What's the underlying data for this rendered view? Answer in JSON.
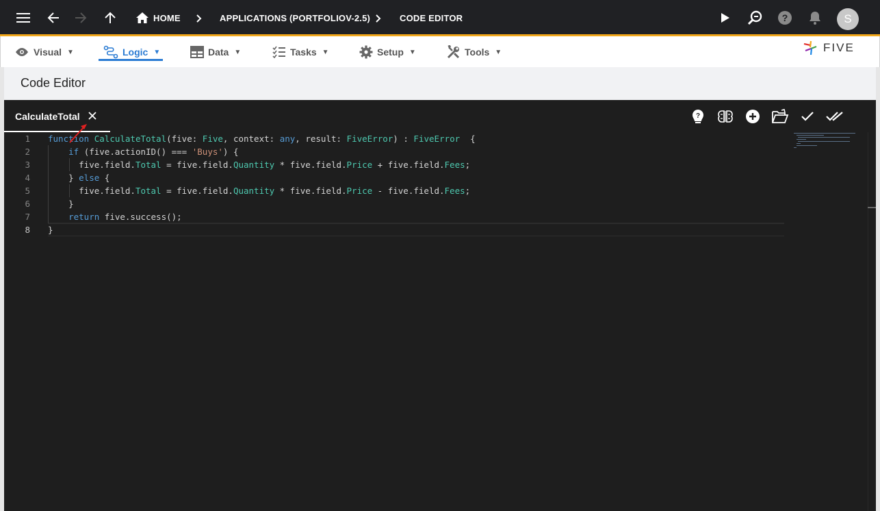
{
  "topbar": {
    "breadcrumbs": [
      "HOME",
      "APPLICATIONS (PORTFOLIOV-2.5)",
      "CODE EDITOR"
    ],
    "avatar_initial": "S"
  },
  "menu": {
    "items": [
      {
        "label": "Visual",
        "icon": "eye-icon"
      },
      {
        "label": "Logic",
        "icon": "logic-icon",
        "active": true
      },
      {
        "label": "Data",
        "icon": "table-icon"
      },
      {
        "label": "Tasks",
        "icon": "checklist-icon"
      },
      {
        "label": "Setup",
        "icon": "gear-icon"
      },
      {
        "label": "Tools",
        "icon": "tools-icon"
      }
    ],
    "caret": "▼",
    "logo_text": "FIVE"
  },
  "page": {
    "title": "Code Editor"
  },
  "editor": {
    "tab_label": "CalculateTotal",
    "line_numbers": [
      "1",
      "2",
      "3",
      "4",
      "5",
      "6",
      "7",
      "8"
    ],
    "current_line": "8"
  },
  "colors": {
    "accent": "#f3a81b",
    "active_menu": "#2a7bd3",
    "editor_bg": "#1e1e1e",
    "keyword": "#569cd6",
    "type": "#4ec9b0",
    "string": "#ce9178"
  }
}
